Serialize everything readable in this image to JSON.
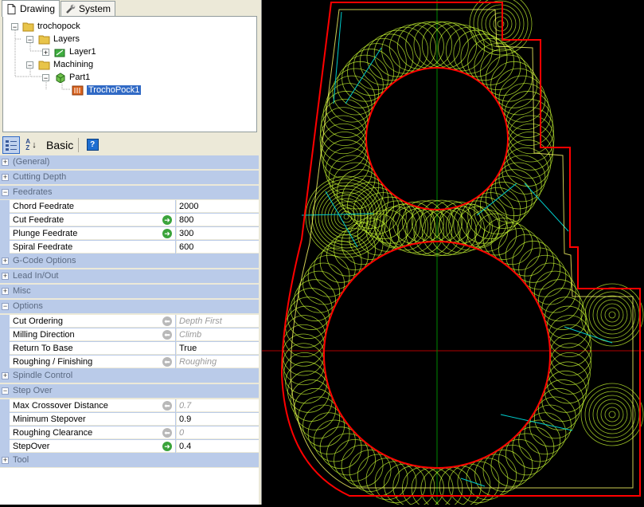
{
  "tabs": [
    {
      "label": "Drawing",
      "icon": "document-icon",
      "active": true
    },
    {
      "label": "System",
      "icon": "wrench-icon",
      "active": false
    }
  ],
  "tree": {
    "root": "trochopock",
    "layers": "Layers",
    "layer1": "Layer1",
    "machining": "Machining",
    "part1": "Part1",
    "operation": "TrochoPock1"
  },
  "toolbar": {
    "categorized_icon": "categorized-icon",
    "sort_icon": "sort-az-icon",
    "sort_label": "AZ",
    "mode": "Basic",
    "help_icon": "help-icon",
    "help_label": "?"
  },
  "grid": {
    "general": "(General)",
    "cutting_depth": "Cutting Depth",
    "feedrates": "Feedrates",
    "chord_feedrate": {
      "name": "Chord Feedrate",
      "value": "2000"
    },
    "cut_feedrate": {
      "name": "Cut Feedrate",
      "value": "800"
    },
    "plunge_feedrate": {
      "name": "Plunge Feedrate",
      "value": "300"
    },
    "spiral_feedrate": {
      "name": "Spiral Feedrate",
      "value": "600"
    },
    "gcode_options": "G-Code Options",
    "lead_in_out": "Lead In/Out",
    "misc": "Misc",
    "options": "Options",
    "cut_ordering": {
      "name": "Cut Ordering",
      "value": "Depth First"
    },
    "milling_direction": {
      "name": "Milling Direction",
      "value": "Climb"
    },
    "return_to_base": {
      "name": "Return To Base",
      "value": "True"
    },
    "roughing_finishing": {
      "name": "Roughing / Finishing",
      "value": "Roughing"
    },
    "spindle_control": "Spindle Control",
    "step_over": "Step Over",
    "max_crossover": {
      "name": "Max Crossover Distance",
      "value": "0.7"
    },
    "min_stepover": {
      "name": "Minimum Stepover",
      "value": "0.9"
    },
    "roughing_clearance": {
      "name": "Roughing Clearance",
      "value": "0"
    },
    "stepover": {
      "name": "StepOver",
      "value": "0.4"
    },
    "tool": "Tool"
  },
  "colors": {
    "boundary": "#ff0000",
    "toolpath": "#ccff33",
    "link_moves": "#00cccc",
    "axis_x": "#b00000",
    "axis_y": "#008800"
  }
}
